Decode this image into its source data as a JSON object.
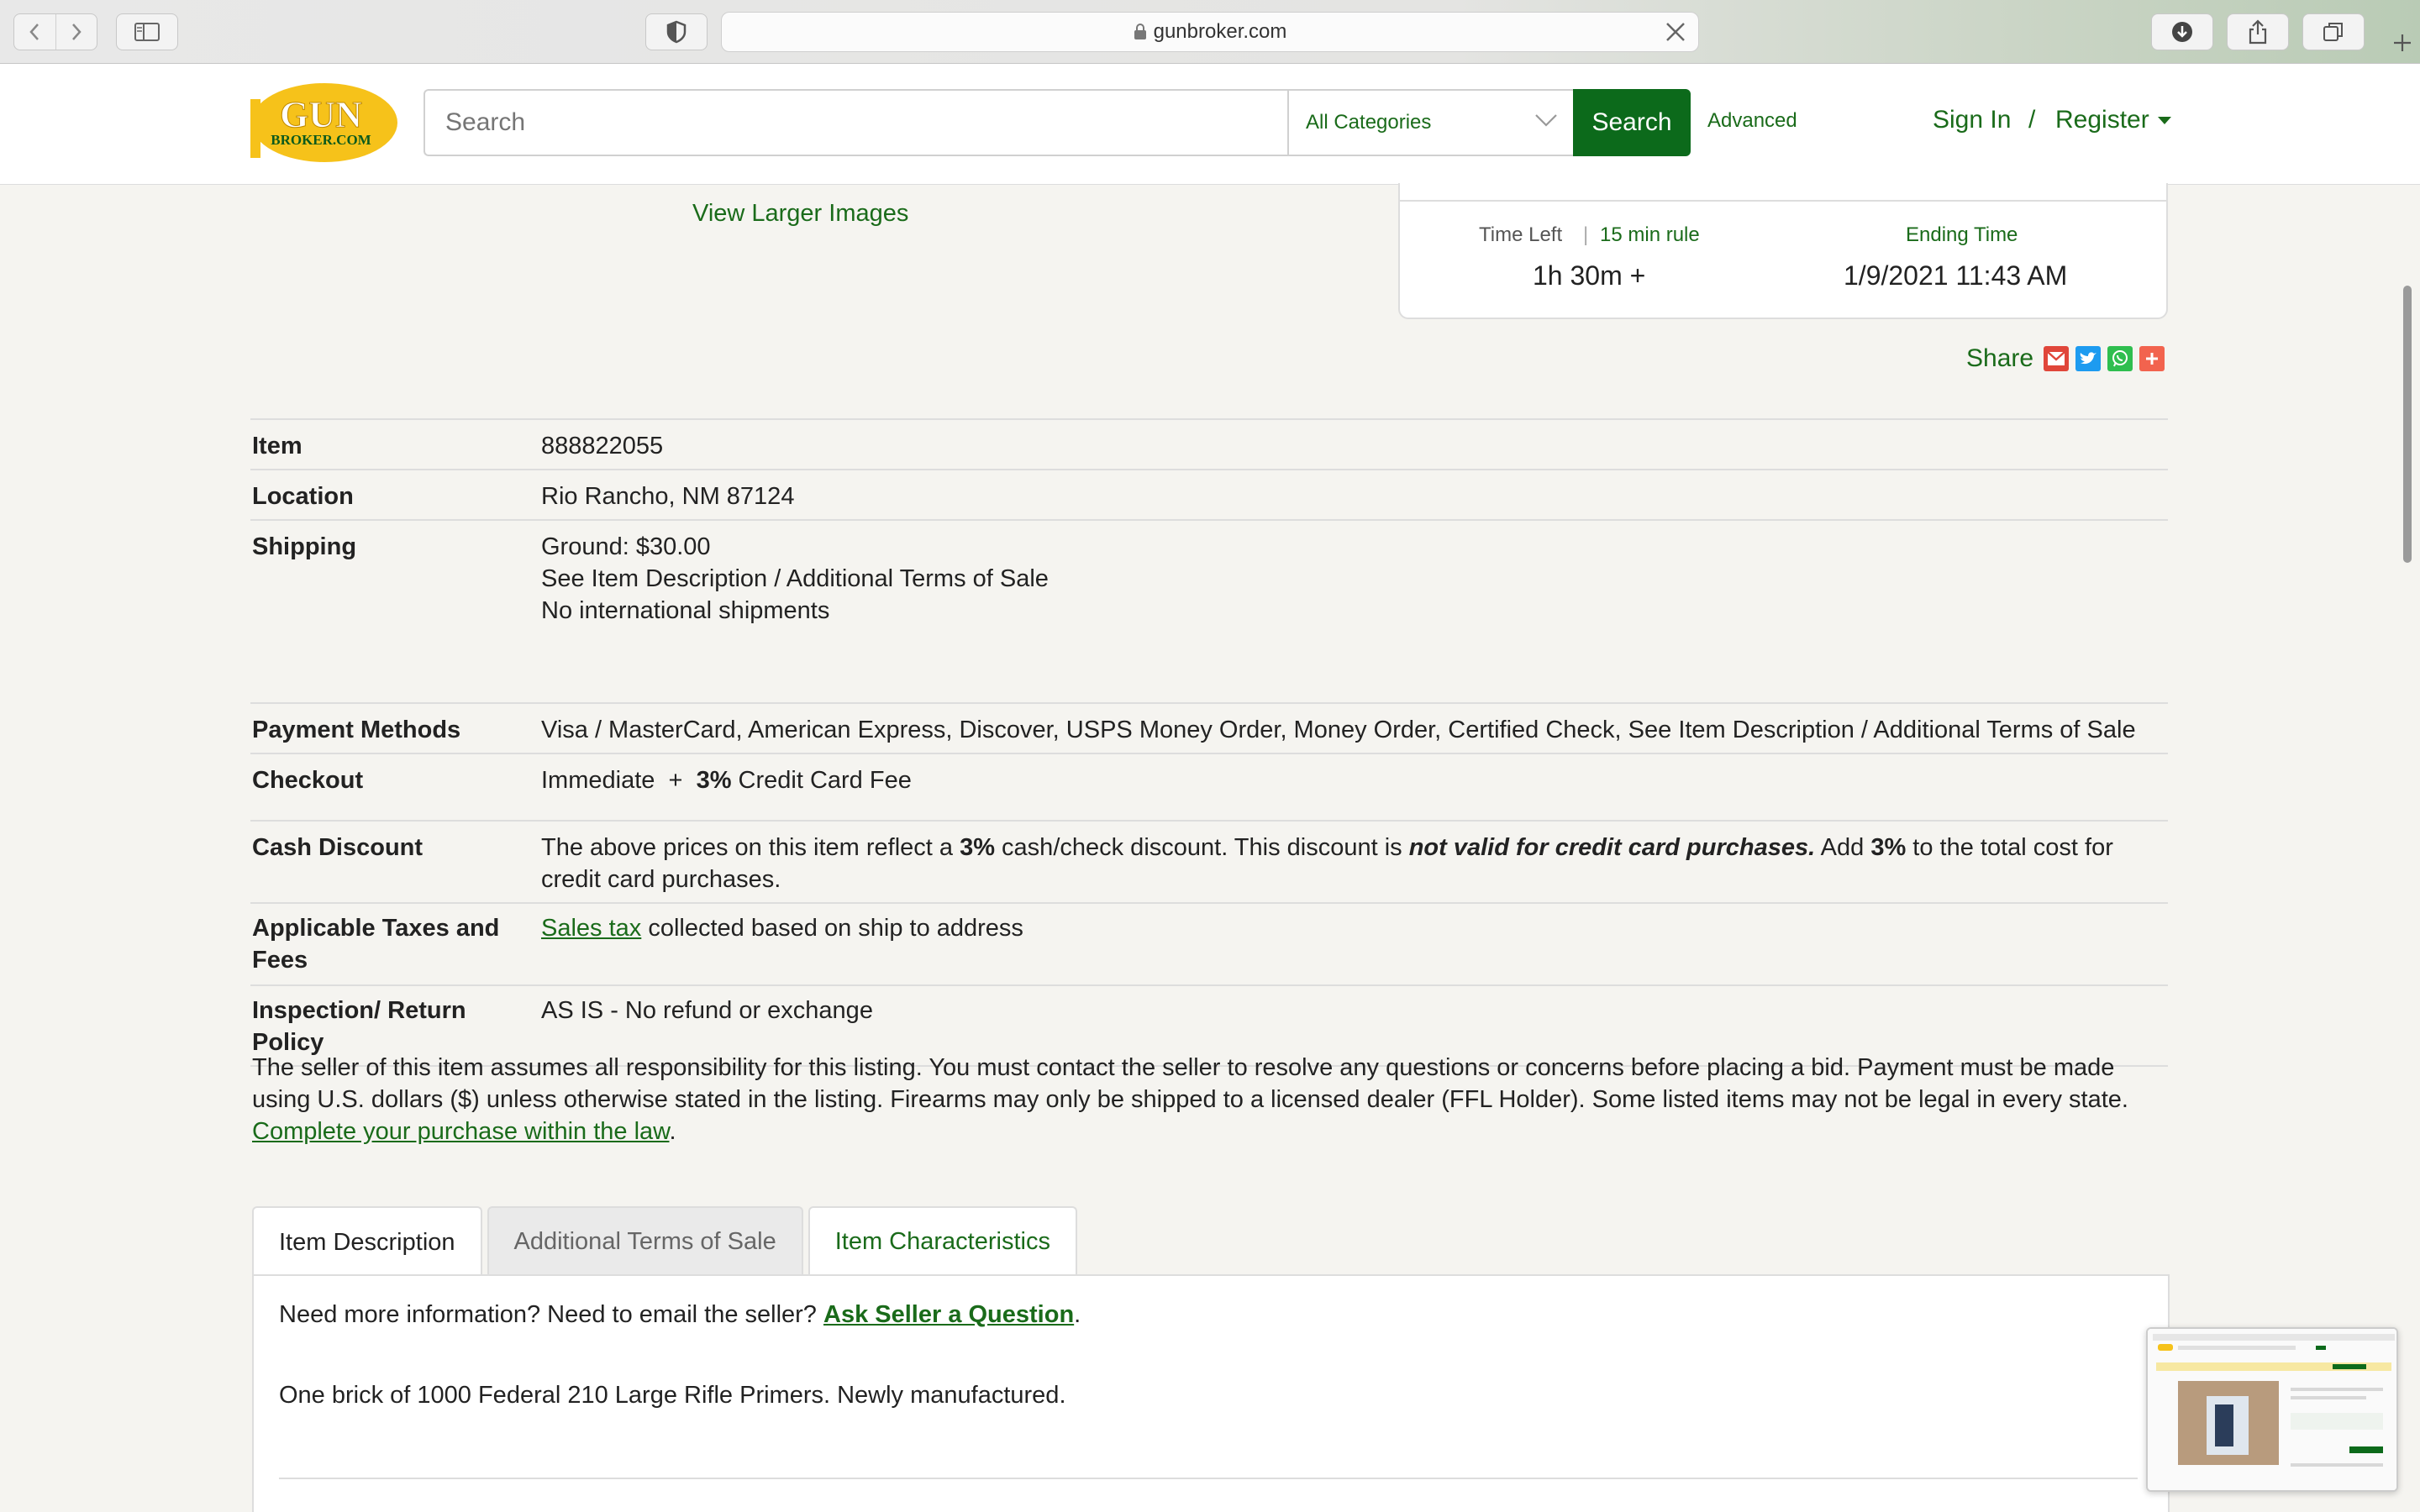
{
  "browser": {
    "url": "gunbroker.com"
  },
  "header": {
    "logo_line1": "GUN",
    "logo_line2": "BROKER.COM",
    "search_placeholder": "Search",
    "category": "All Categories",
    "search_button": "Search",
    "advanced": "Advanced",
    "sign_in": "Sign In",
    "separator": "/",
    "register": "Register"
  },
  "listing": {
    "view_larger": "View Larger Images",
    "time_left_label": "Time Left",
    "rule_separator": "|",
    "rule_link": "15 min rule",
    "time_left_value": "1h 30m +",
    "ending_label": "Ending Time",
    "ending_value": "1/9/2021 11:43 AM",
    "share_label": "Share"
  },
  "details": {
    "item_label": "Item",
    "item_value": "888822055",
    "location_label": "Location",
    "location_value": "Rio Rancho, NM 87124",
    "shipping_label": "Shipping",
    "shipping_ground": "Ground: $30.00",
    "shipping_terms": "See Item Description / Additional Terms of Sale",
    "shipping_intl": "No international shipments",
    "payment_label": "Payment Methods",
    "payment_value": "Visa / MasterCard, American Express, Discover, USPS Money Order, Money Order, Certified Check, See Item Description / Additional Terms of Sale",
    "checkout_label": "Checkout",
    "checkout_prefix": "Immediate  +  ",
    "checkout_pct": "3%",
    "checkout_suffix": " Credit Card Fee",
    "cash_label": "Cash Discount",
    "cash_1": "The above prices on this item reflect a ",
    "cash_pct1": "3%",
    "cash_2": " cash/check discount. This discount is ",
    "cash_em": "not valid for credit card purchases.",
    "cash_3": " Add ",
    "cash_pct2": "3%",
    "cash_4": " to the total cost for credit card purchases.",
    "taxes_label": "Applicable Taxes and Fees",
    "taxes_link": "Sales tax",
    "taxes_rest": " collected based on ship to address",
    "inspection_label": "Inspection/ Return Policy",
    "inspection_value": "AS IS - No refund or exchange"
  },
  "disclaimer": {
    "text": "The seller of this item assumes all responsibility for this listing. You must contact the seller to resolve any questions or concerns before placing a bid. Payment must be made using U.S. dollars ($) unless otherwise stated in the listing. Firearms may only be shipped to a licensed dealer (FFL Holder). Some listed items may not be legal in every state.",
    "link": "Complete your purchase within the law",
    "period": "."
  },
  "tabs": [
    {
      "label": "Item Description"
    },
    {
      "label": "Additional Terms of Sale"
    },
    {
      "label": "Item Characteristics"
    }
  ],
  "panel": {
    "ask_prefix": "Need more information? Need to email the seller? ",
    "ask_link": "Ask Seller a Question",
    "ask_suffix": ".",
    "description": "One brick of 1000 Federal 210 Large Rifle Primers. Newly manufactured."
  },
  "colors": {
    "brand_green": "#0c6a1b",
    "logo_yellow": "#f6c21a"
  }
}
